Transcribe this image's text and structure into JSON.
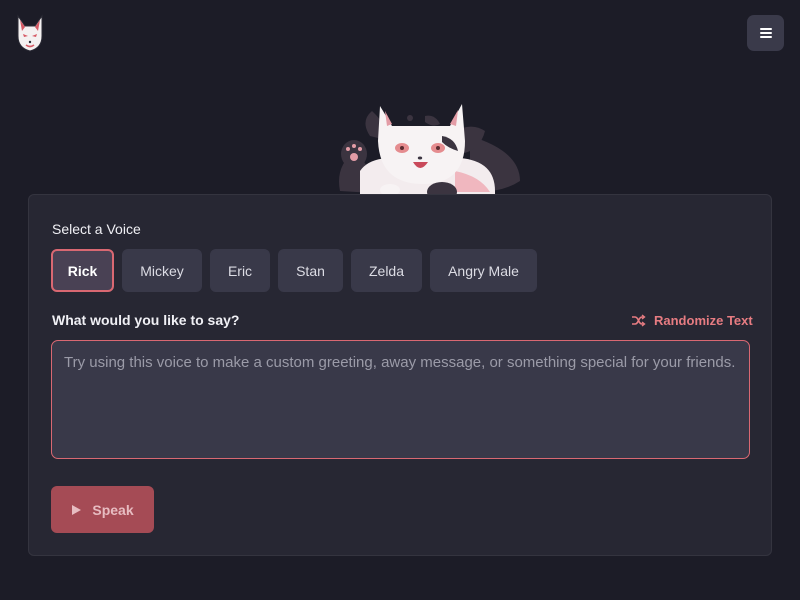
{
  "header": {
    "logo_icon": "fox-mask-logo-icon",
    "menu_icon": "hamburger-menu-icon"
  },
  "mascot": {
    "icon": "fox-mascot-illustration"
  },
  "voice_section": {
    "label": "Select a Voice",
    "voices": [
      {
        "label": "Rick",
        "selected": true
      },
      {
        "label": "Mickey",
        "selected": false
      },
      {
        "label": "Eric",
        "selected": false
      },
      {
        "label": "Stan",
        "selected": false
      },
      {
        "label": "Zelda",
        "selected": false
      },
      {
        "label": "Angry Male",
        "selected": false
      }
    ]
  },
  "message_section": {
    "label": "What would you like to say?",
    "randomize_label": "Randomize Text",
    "randomize_icon": "shuffle-icon",
    "placeholder": "Try using this voice to make a custom greeting, away message, or something special for your friends.",
    "value": ""
  },
  "speak_button": {
    "label": "Speak",
    "icon": "play-icon"
  },
  "colors": {
    "background": "#1c1c27",
    "card": "#272733",
    "accent": "#d96872",
    "button": "#393949",
    "speak_button": "#a54b55"
  }
}
